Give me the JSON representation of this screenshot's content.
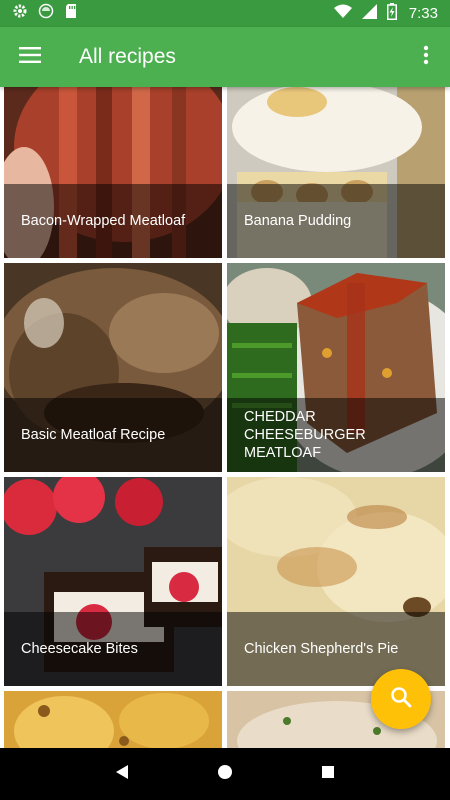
{
  "status_bar": {
    "time": "7:33",
    "left_icons": [
      "gear-icon",
      "circle-icon",
      "sd-card-icon"
    ],
    "right_icons": [
      "wifi-icon",
      "signal-icon",
      "battery-charging-icon"
    ]
  },
  "app_bar": {
    "title": "All recipes",
    "menu_icon": "hamburger-menu-icon",
    "overflow_icon": "more-vert-icon"
  },
  "recipes": [
    {
      "title": "Bacon-Wrapped Meatloaf"
    },
    {
      "title": "Banana Pudding"
    },
    {
      "title": "Basic Meatloaf Recipe"
    },
    {
      "title": "CHEDDAR CHEESEBURGER MEATLOAF"
    },
    {
      "title": "Cheesecake Bites"
    },
    {
      "title": "Chicken Shepherd's Pie"
    },
    {
      "title": ""
    },
    {
      "title": ""
    }
  ],
  "fab": {
    "icon": "search-icon"
  },
  "colors": {
    "status_bar": "#3a9a3f",
    "app_bar": "#4caf50",
    "fab": "#ffc107",
    "nav_bar": "#000000"
  },
  "nav_bar": {
    "icons": [
      "back-icon",
      "home-icon",
      "recents-icon"
    ]
  }
}
